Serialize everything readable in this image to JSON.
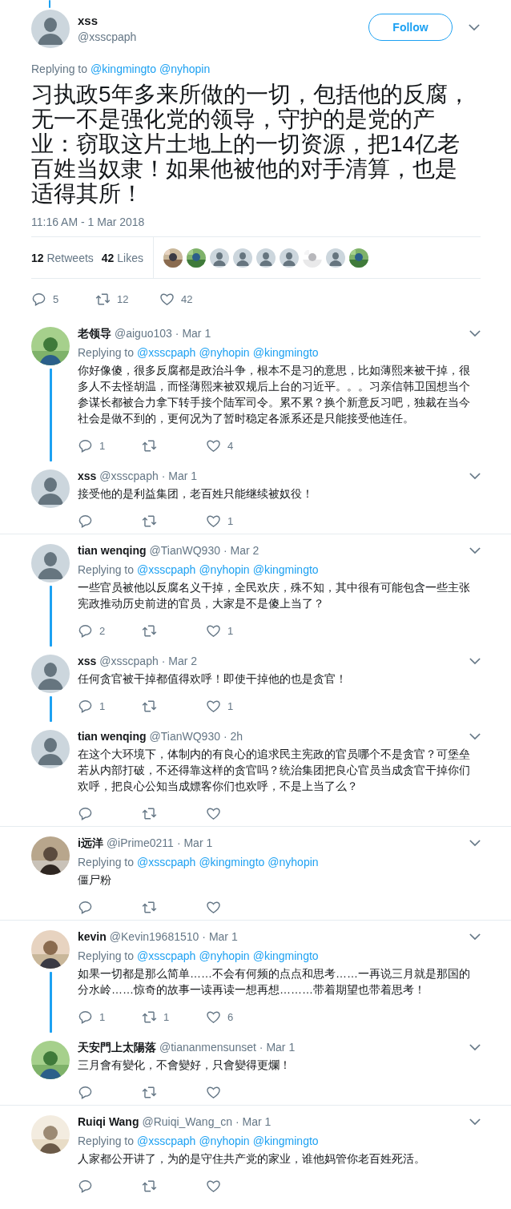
{
  "main_tweet": {
    "name": "xss",
    "handle": "@xsscpaph",
    "avatar": {
      "kind": "default"
    },
    "follow_button": "Follow",
    "replying_label": "Replying to",
    "replying_to": [
      "@kingmingto",
      "@nyhopin"
    ],
    "text": "习执政5年多来所做的一切，包括他的反腐，无一不是强化党的领导，守护的是党的产业：窃取这片土地上的一切资源，把14亿老百姓当奴隶！如果他被他的对手清算，也是适得其所！",
    "timestamp": "11:16 AM - 1 Mar 2018",
    "stats": [
      {
        "count": "12",
        "label": "Retweets"
      },
      {
        "count": "42",
        "label": "Likes"
      }
    ],
    "liker_avatars": [
      {
        "kind": "picture"
      },
      {
        "kind": "picture"
      },
      {
        "kind": "default"
      },
      {
        "kind": "default"
      },
      {
        "kind": "default"
      },
      {
        "kind": "default"
      },
      {
        "kind": "picture"
      },
      {
        "kind": "default"
      },
      {
        "kind": "picture"
      }
    ],
    "reply_count": "5",
    "retweet_count": "12",
    "like_count": "42"
  },
  "reply_groups": [
    {
      "tweets": [
        {
          "name": "老领导",
          "handle": "@aiguo103",
          "time": "· Mar 1",
          "avatar": {
            "kind": "picture"
          },
          "replying_label": "Replying to",
          "replying_to": [
            "@xsscpaph",
            "@nyhopin",
            "@kingmingto"
          ],
          "text": "你好像傻，很多反腐都是政治斗争，根本不是习的意思，比如薄熙来被干掉，很多人不去怪胡温，而怪薄熙来被双规后上台的习近平。。。习亲信韩卫国想当个参谋长都被合力拿下转手接个陆军司令。累不累？换个新意反习吧，独裁在当今社会是做不到的，更何况为了暂时稳定各派系还是只能接受他连任。",
          "reply_count": "1",
          "like_count": "4"
        },
        {
          "name": "xss",
          "handle": "@xsscpaph",
          "time": "· Mar 1",
          "avatar": {
            "kind": "default"
          },
          "text": "接受他的是利益集团，老百姓只能继续被奴役！",
          "like_count": "1"
        }
      ]
    },
    {
      "tweets": [
        {
          "name": "tian wenqing",
          "handle": "@TianWQ930",
          "time": "· Mar 2",
          "avatar": {
            "kind": "default"
          },
          "replying_label": "Replying to",
          "replying_to": [
            "@xsscpaph",
            "@nyhopin",
            "@kingmingto"
          ],
          "text": "一些官员被他以反腐名义干掉，全民欢庆，殊不知，其中很有可能包含一些主张宪政推动历史前进的官员，大家是不是傻上当了？",
          "reply_count": "2",
          "like_count": "1"
        },
        {
          "name": "xss",
          "handle": "@xsscpaph",
          "time": "· Mar 2",
          "avatar": {
            "kind": "default"
          },
          "text": "任何贪官被干掉都值得欢呼！即使干掉他的也是贪官！",
          "reply_count": "1",
          "like_count": "1"
        },
        {
          "name": "tian wenqing",
          "handle": "@TianWQ930",
          "time": "· 2h",
          "avatar": {
            "kind": "default"
          },
          "text": "在这个大环境下，体制内的有良心的追求民主宪政的官员哪个不是贪官？可堡垒若从内部打破，不还得靠这样的贪官吗？统治集团把良心官员当成贪官干掉你们欢呼，把良心公知当成嫖客你们也欢呼，不是上当了么？"
        }
      ]
    },
    {
      "tweets": [
        {
          "name": "i远洋",
          "handle": "@iPrime0211",
          "time": "· Mar 1",
          "avatar": {
            "kind": "picture"
          },
          "replying_label": "Replying to",
          "replying_to": [
            "@xsscpaph",
            "@kingmingto",
            "@nyhopin"
          ],
          "text": "僵尸粉"
        }
      ]
    },
    {
      "tweets": [
        {
          "name": "kevin",
          "handle": "@Kevin19681510",
          "time": "· Mar 1",
          "avatar": {
            "kind": "picture"
          },
          "replying_label": "Replying to",
          "replying_to": [
            "@xsscpaph",
            "@nyhopin",
            "@kingmingto"
          ],
          "text": "如果一切都是那么简单……不会有何频的点点和思考……一再说三月就是那国的分水岭……惊奇的故事一读再读一想再想………带着期望也带着思考！",
          "reply_count": "1",
          "retweet_count": "1",
          "like_count": "6"
        },
        {
          "name": "天安門上太陽落",
          "handle": "@tiananmensunset",
          "time": "· Mar 1",
          "avatar": {
            "kind": "picture"
          },
          "text": "三月會有變化，不會變好，只會變得更爛！"
        }
      ]
    },
    {
      "tweets": [
        {
          "name": "Ruiqi Wang",
          "handle": "@Ruiqi_Wang_cn",
          "time": "· Mar 1",
          "avatar": {
            "kind": "picture"
          },
          "replying_label": "Replying to",
          "replying_to": [
            "@xsscpaph",
            "@nyhopin",
            "@kingmingto"
          ],
          "text": "人家都公开讲了，为的是守住共产党的家业，谁他妈管你老百姓死活。"
        }
      ]
    }
  ]
}
